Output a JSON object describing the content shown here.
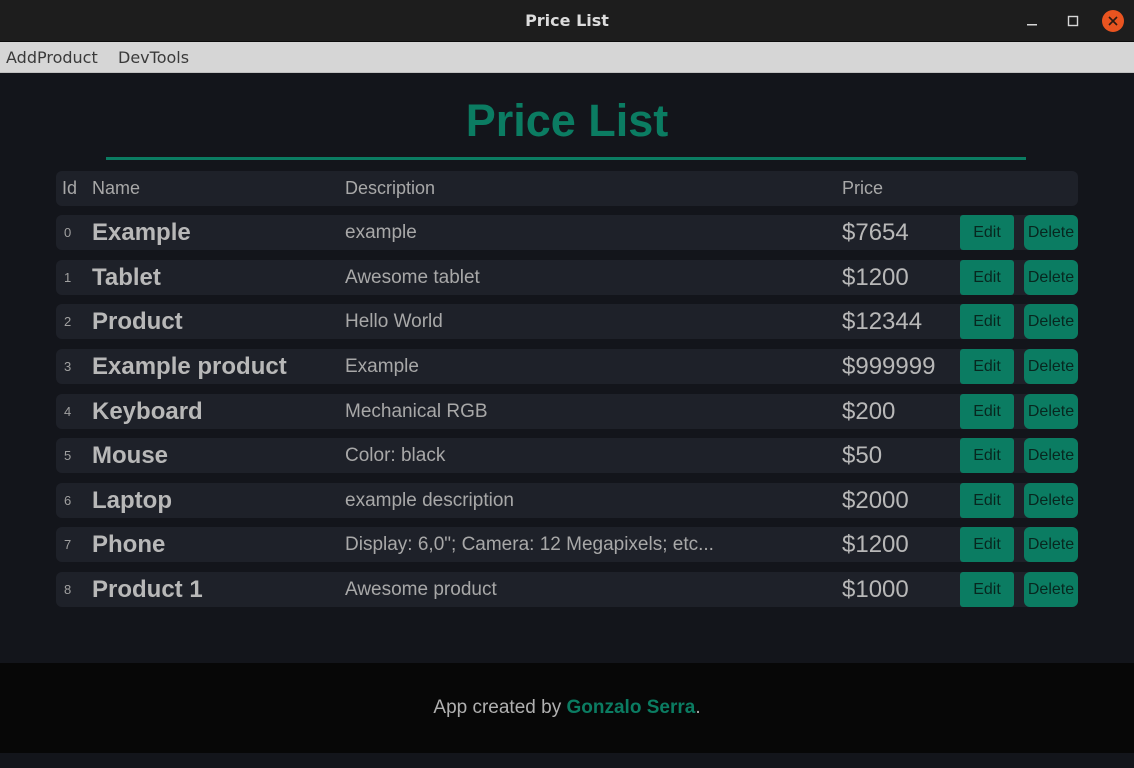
{
  "window": {
    "title": "Price List"
  },
  "menu": {
    "items": [
      "AddProduct",
      "DevTools"
    ]
  },
  "page": {
    "title": "Price List"
  },
  "table": {
    "headers": {
      "id": "Id",
      "name": "Name",
      "description": "Description",
      "price": "Price"
    },
    "rows": [
      {
        "id": "0",
        "name": "Example",
        "description": "example",
        "price": "$7654",
        "edit": "Edit",
        "delete": "Delete"
      },
      {
        "id": "1",
        "name": "Tablet",
        "description": "Awesome tablet",
        "price": "$1200",
        "edit": "Edit",
        "delete": "Delete"
      },
      {
        "id": "2",
        "name": "Product",
        "description": "Hello World",
        "price": "$12344",
        "edit": "Edit",
        "delete": "Delete"
      },
      {
        "id": "3",
        "name": "Example product",
        "description": "Example",
        "price": "$999999",
        "edit": "Edit",
        "delete": "Delete"
      },
      {
        "id": "4",
        "name": "Keyboard",
        "description": "Mechanical RGB",
        "price": "$200",
        "edit": "Edit",
        "delete": "Delete"
      },
      {
        "id": "5",
        "name": "Mouse",
        "description": "Color: black",
        "price": "$50",
        "edit": "Edit",
        "delete": "Delete"
      },
      {
        "id": "6",
        "name": "Laptop",
        "description": "example description",
        "price": "$2000",
        "edit": "Edit",
        "delete": "Delete"
      },
      {
        "id": "7",
        "name": "Phone",
        "description": "Display: 6,0\"; Camera: 12 Megapixels; etc...",
        "price": "$1200",
        "edit": "Edit",
        "delete": "Delete"
      },
      {
        "id": "8",
        "name": "Product 1",
        "description": "Awesome product",
        "price": "$1000",
        "edit": "Edit",
        "delete": "Delete"
      }
    ]
  },
  "footer": {
    "prefix": "App created by ",
    "author": "Gonzalo Serra",
    "suffix": "."
  },
  "colors": {
    "accent": "#0b7c62",
    "background": "#13151b",
    "row": "#1e2129",
    "close_button": "#e95420"
  }
}
